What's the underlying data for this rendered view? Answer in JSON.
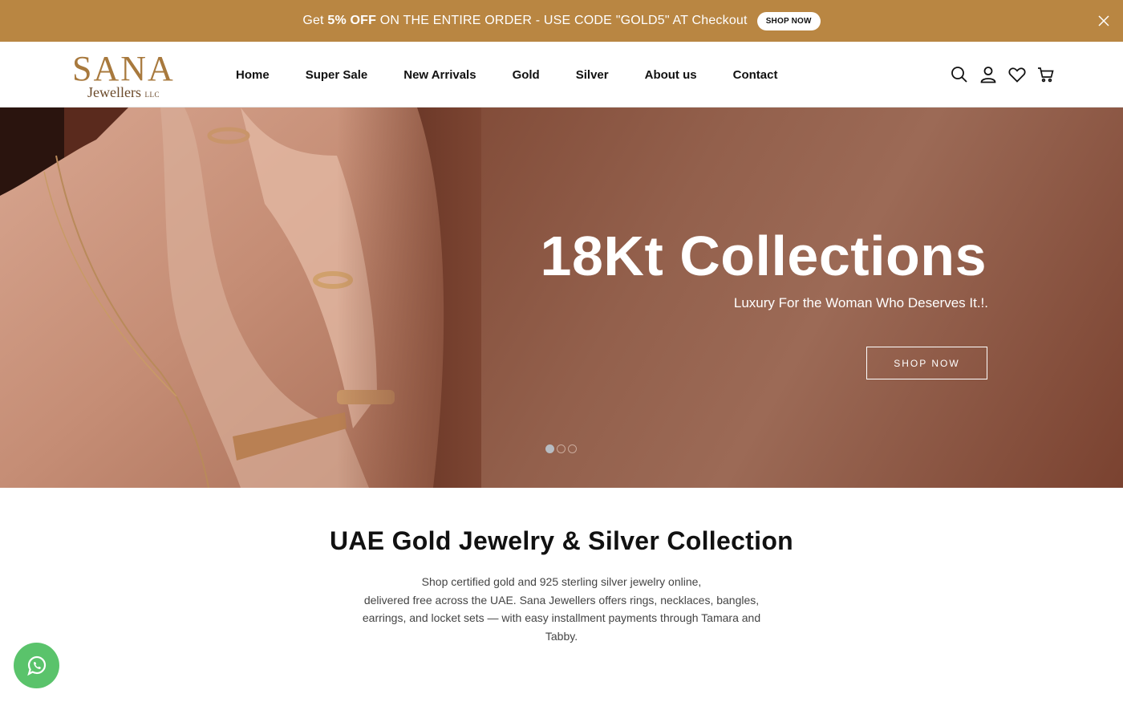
{
  "announcement": {
    "prefix": "Get ",
    "highlight": "5% OFF",
    "suffix": " ON THE ENTIRE ORDER - USE CODE \"GOLD5\" AT Checkout",
    "button_label": "SHOP NOW"
  },
  "header": {
    "logo_main": "SANA",
    "logo_sub": "Jewellers",
    "logo_llc": "LLC",
    "nav": [
      "Home",
      "Super Sale",
      "New Arrivals",
      "Gold",
      "Silver",
      "About us",
      "Contact"
    ],
    "icons": [
      "search-icon",
      "account-icon",
      "wishlist-heart-icon",
      "cart-icon"
    ]
  },
  "hero": {
    "title": "18Kt Collections",
    "subtitle": "Luxury For the Woman Who Deserves It.!.",
    "button_label": "SHOP NOW",
    "slide_count": 3,
    "active_slide": 1
  },
  "intro": {
    "title": "UAE Gold Jewelry & Silver Collection",
    "line1": "Shop certified gold and 925 sterling silver jewelry online,",
    "line2": "delivered free across the UAE. Sana Jewellers offers rings, necklaces, bangles,",
    "line3": "earrings, and locket sets — with easy installment payments through Tamara and",
    "line4": "Tabby."
  },
  "colors": {
    "announcement_bg": "#b98642",
    "brand_gold": "#a8793d",
    "hero_bg": "#7c4532",
    "whatsapp": "#5ac36b"
  }
}
